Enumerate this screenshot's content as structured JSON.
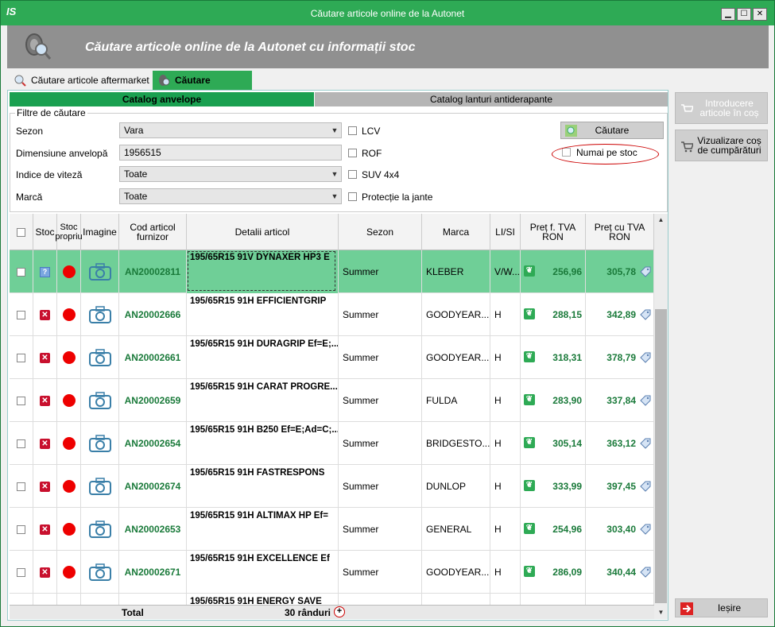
{
  "window": {
    "title": "Căutare articole online de la Autonet",
    "app_icon": "IS",
    "controls": {
      "minimize": "▁",
      "maximize": "☐",
      "close": "✕"
    }
  },
  "header": {
    "title": "Căutare articole online de la Autonet cu informații stoc"
  },
  "tabs": [
    {
      "label": "Căutare articole aftermarket",
      "active": false
    },
    {
      "label": "Căutare anvelope",
      "active": true
    }
  ],
  "subtabs": [
    {
      "label": "Catalog anvelope",
      "active": true
    },
    {
      "label": "Catalog lanturi antiderapante",
      "active": false
    }
  ],
  "filters": {
    "legend": "Filtre de căutare",
    "season_label": "Sezon",
    "season_value": "Vara",
    "dimension_label": "Dimensiune anvelopă",
    "dimension_value": "1956515",
    "speed_label": "Indice de viteză",
    "speed_value": "Toate",
    "brand_label": "Marcă",
    "brand_value": "Toate",
    "lcv_label": "LCV",
    "rof_label": "ROF",
    "suv_label": "SUV 4x4",
    "rim_label": "Protecție la jante",
    "search_button": "Căutare",
    "stock_only_label": "Numai pe stoc"
  },
  "side_buttons": {
    "add_to_cart": "Introducere articole în coș",
    "view_cart": "Vizualizare coș de cumpărături",
    "exit": "Ieșire"
  },
  "grid": {
    "columns": {
      "stock": "Stoc",
      "own_stock": "Stoc propriu",
      "image": "Imagine",
      "code": "Cod articol furnizor",
      "details": "Detalii articol",
      "season": "Sezon",
      "brand": "Marca",
      "li_si": "LI/SI",
      "price_no_vat": "Preț f. TVA RON",
      "price_vat": "Preț cu TVA RON"
    },
    "rows": [
      {
        "code": "AN20002811",
        "details": "195/65R15 91V DYNAXER HP3 E",
        "season": "Summer",
        "brand": "KLEBER",
        "lisi": "V/W...",
        "p1": "256,96",
        "p2": "305,78",
        "stock": "question",
        "selected": true
      },
      {
        "code": "AN20002666",
        "details": "195/65R15 91H EFFICIENTGRIP",
        "season": "Summer",
        "brand": "GOODYEAR...",
        "lisi": "H",
        "p1": "288,15",
        "p2": "342,89",
        "stock": "x",
        "selected": false
      },
      {
        "code": "AN20002661",
        "details": "195/65R15 91H DURAGRIP Ef=E;...",
        "season": "Summer",
        "brand": "GOODYEAR...",
        "lisi": "H",
        "p1": "318,31",
        "p2": "378,79",
        "stock": "x",
        "selected": false
      },
      {
        "code": "AN20002659",
        "details": "195/65R15 91H CARAT PROGRE...",
        "season": "Summer",
        "brand": "FULDA",
        "lisi": "H",
        "p1": "283,90",
        "p2": "337,84",
        "stock": "x",
        "selected": false
      },
      {
        "code": "AN20002654",
        "details": "195/65R15 91H B250 Ef=E;Ad=C;...",
        "season": "Summer",
        "brand": "BRIDGESTO...",
        "lisi": "H",
        "p1": "305,14",
        "p2": "363,12",
        "stock": "x",
        "selected": false
      },
      {
        "code": "AN20002674",
        "details": "195/65R15 91H FASTRESPONS",
        "season": "Summer",
        "brand": "DUNLOP",
        "lisi": "H",
        "p1": "333,99",
        "p2": "397,45",
        "stock": "x",
        "selected": false
      },
      {
        "code": "AN20002653",
        "details": "195/65R15 91H ALTIMAX HP Ef=",
        "season": "Summer",
        "brand": "GENERAL",
        "lisi": "H",
        "p1": "254,96",
        "p2": "303,40",
        "stock": "x",
        "selected": false
      },
      {
        "code": "AN20002671",
        "details": "195/65R15 91H EXCELLENCE Ef",
        "season": "Summer",
        "brand": "GOODYEAR...",
        "lisi": "H",
        "p1": "286,09",
        "p2": "340,44",
        "stock": "x",
        "selected": false
      },
      {
        "code": "",
        "details": "195/65R15 91H ENERGY SAVE",
        "season": "",
        "brand": "",
        "lisi": "",
        "p1": "",
        "p2": "",
        "stock": "",
        "selected": false
      }
    ],
    "footer": {
      "total_label": "Total",
      "count": "30 rânduri",
      "plus": "+"
    }
  },
  "colors": {
    "accent": "#2eaa55",
    "selected_row": "#6fcf97",
    "price": "#1a7a3a",
    "stock_dot": "#e00000"
  }
}
